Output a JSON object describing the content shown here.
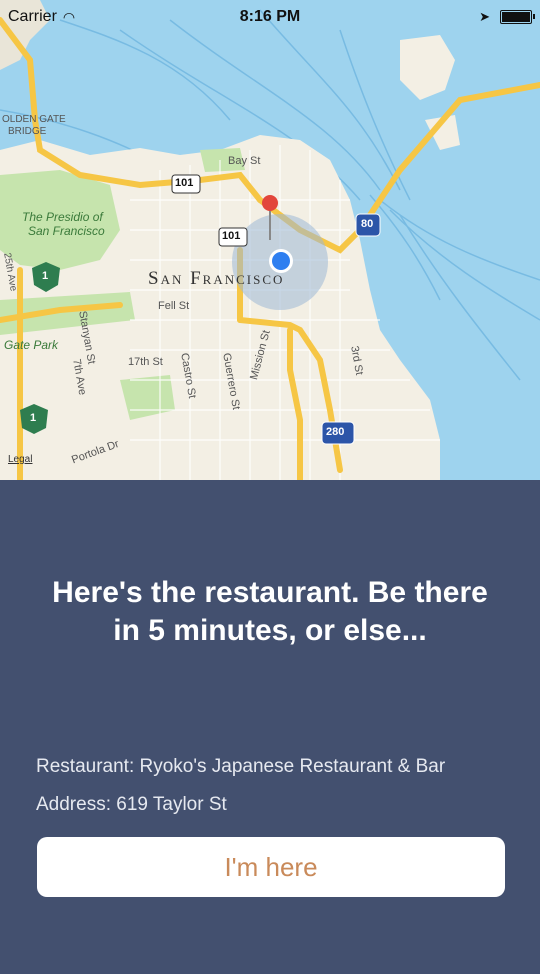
{
  "status_bar": {
    "carrier": "Carrier",
    "time": "8:16 PM"
  },
  "map": {
    "city_label": "San Francisco",
    "bridge_label_1": "OLDEN GATE",
    "bridge_label_2": "BRIDGE",
    "presidio_label_1": "The Presidio of",
    "presidio_label_2": "San Francisco",
    "gate_park_label": "Gate Park",
    "bay_st": "Bay St",
    "fell_st": "Fell St",
    "stanyan_st": "Stanyan St",
    "castro_st": "Castro St",
    "guerrero_st": "Guerrero St",
    "mission_st": "Mission St",
    "street_17th": "17th St",
    "ave_7th": "7th Ave",
    "ave_25th": "25th Ave",
    "third_st": "3rd St",
    "portola_dr": "Portola Dr",
    "legal_label": "Legal",
    "route_101": "101",
    "route_80": "80",
    "route_280": "280",
    "route_1": "1"
  },
  "info": {
    "headline": "Here's the restaurant. Be there in 5 minutes, or else...",
    "restaurant": "Restaurant: Ryoko's Japanese Restaurant & Bar",
    "address": "Address: 619 Taylor St",
    "button_label": "I'm here"
  },
  "colors": {
    "panel_bg": "#43506f",
    "water": "#9ed3ee",
    "land": "#f3efe4",
    "park": "#c6e4ad",
    "highway": "#f6c645",
    "button_text": "#c98a5a",
    "user_dot": "#2f7ff0",
    "pin": "#e2463b"
  }
}
